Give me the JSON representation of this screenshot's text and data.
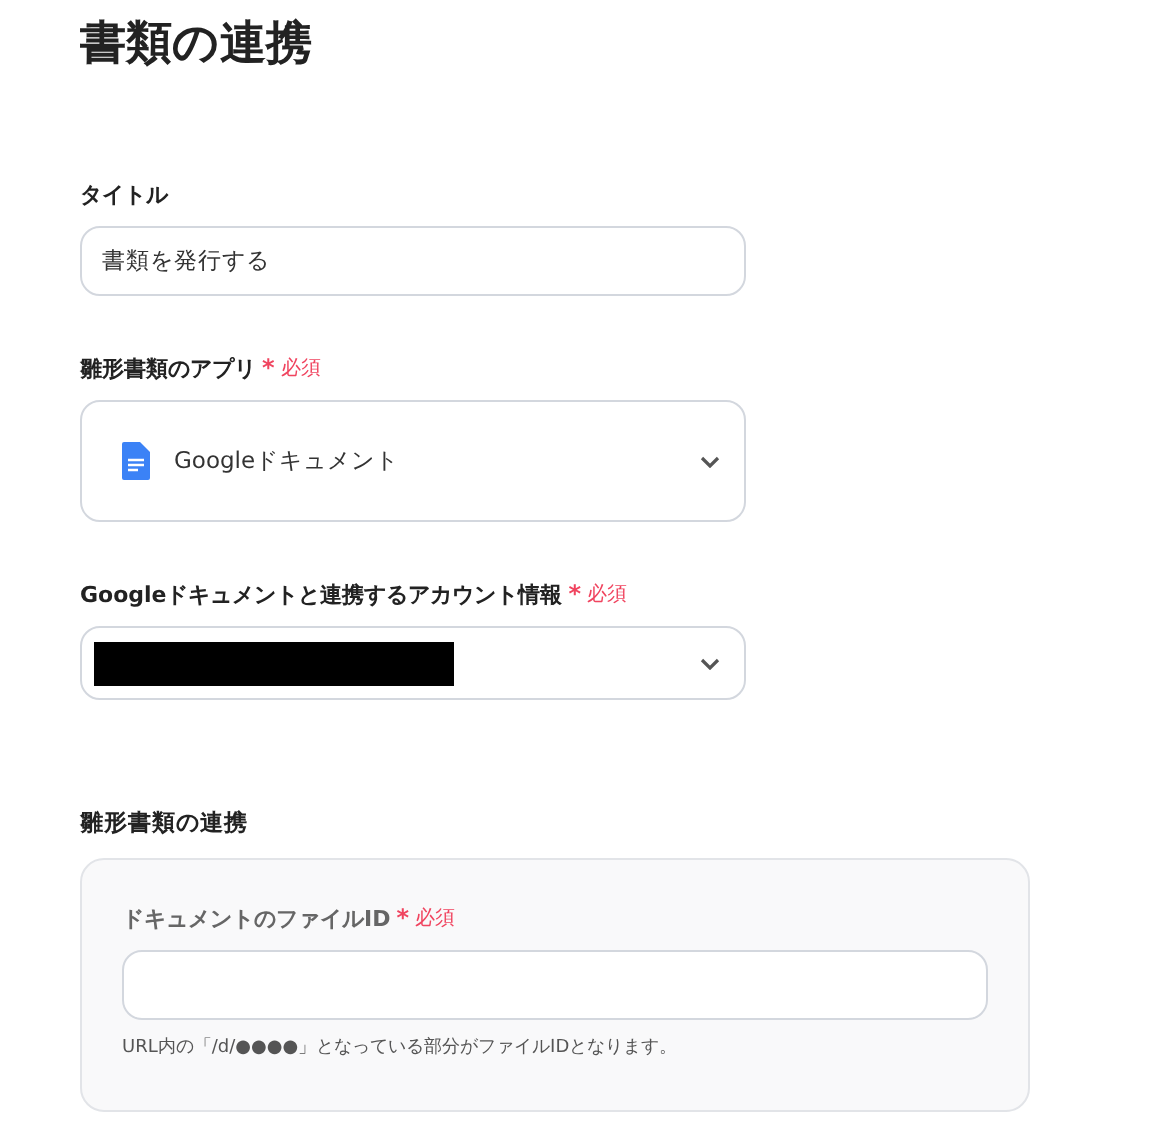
{
  "title": "書類の連携",
  "fields": [
    {
      "kind": "text",
      "label": "タイトル",
      "value": "書類を発行する"
    },
    {
      "kind": "app-select",
      "label": "雛形書類のアプリ",
      "required_mark": "*",
      "required_text": "必須",
      "value": "Googleドキュメント"
    },
    {
      "kind": "select",
      "label": "Googleドキュメントと連携するアカウント情報",
      "required_mark": "*",
      "required_text": "必須",
      "redacted": true
    }
  ],
  "section": {
    "title": "雛形書類の連携",
    "fields": [
      {
        "kind": "text",
        "label": "ドキュメントのファイルID",
        "required_mark": "*",
        "required_text": "必須",
        "hint": "URL内の「/d/●●●●」となっている部分がファイルIDとなります。"
      }
    ]
  }
}
